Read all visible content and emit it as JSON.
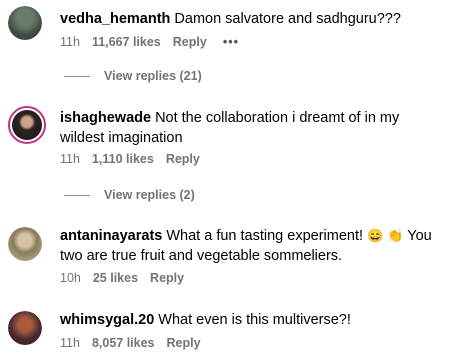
{
  "comments": [
    {
      "username": "vedha_hemanth",
      "text": "Damon salvatore and sadhguru???",
      "time": "11h",
      "likes": "11,667 likes",
      "reply": "Reply",
      "more": "•••",
      "view_replies": "View replies (21)"
    },
    {
      "username": "ishaghewade",
      "text": "Not the collaboration i dreamt of in my wildest imagination",
      "time": "11h",
      "likes": "1,110 likes",
      "reply": "Reply",
      "view_replies": "View replies (2)"
    },
    {
      "username": "antaninayarats",
      "text_part1": "What a fun tasting experiment!",
      "emoji1": "😄",
      "emoji2": "👏",
      "text_part2": "You two are true fruit and vegetable sommeliers.",
      "time": "10h",
      "likes": "25 likes",
      "reply": "Reply"
    },
    {
      "username": "whimsygal.20",
      "text": "What even is this multiverse?!",
      "time": "11h",
      "likes": "8,057 likes",
      "reply": "Reply"
    }
  ],
  "colors": {
    "meta_gray": "#737373",
    "story_ring": "#c13584"
  }
}
